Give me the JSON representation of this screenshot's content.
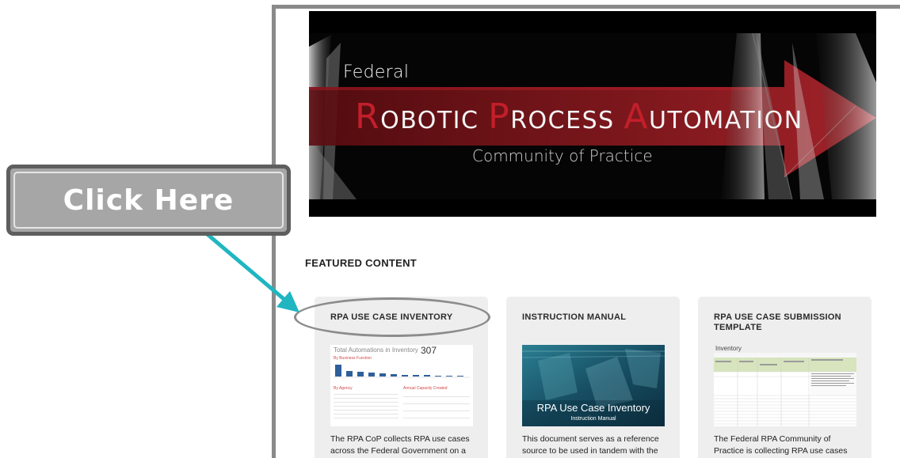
{
  "banner": {
    "subtitle": "Federal",
    "title_words": [
      {
        "cap": "R",
        "rest": "OBOTIC"
      },
      {
        "cap": "P",
        "rest": "ROCESS"
      },
      {
        "cap": "A",
        "rest": "UTOMATION"
      }
    ],
    "community": "Community of Practice"
  },
  "featured": {
    "heading": "FEATURED CONTENT",
    "cards": [
      {
        "title": "RPA USE CASE INVENTORY",
        "description": "The RPA CoP collects RPA use cases across the Federal Government on a",
        "thumb": {
          "heading": "Total Automations in Inventory",
          "total": "307",
          "section1": "By Business Function",
          "section2": "By Agency",
          "section3": "Annual Capacity Created"
        }
      },
      {
        "title": "INSTRUCTION MANUAL",
        "description": "This document serves as a reference source to be used in tandem with the Use",
        "thumb": {
          "title": "RPA Use Case Inventory",
          "subtitle": "Instruction Manual"
        }
      },
      {
        "title": "RPA USE CASE SUBMISSION TEMPLATE",
        "description": "The Federal RPA Community of Practice is collecting RPA use cases from teams",
        "thumb": {
          "title": "Inventory"
        }
      }
    ]
  },
  "callout": {
    "label": "Click Here",
    "colors": {
      "box": "#a6a6a6",
      "border": "#5e5e5e",
      "arrow": "#1fb6c1",
      "ellipse": "#8c8c8c"
    }
  },
  "colors": {
    "accent_red": "#c21f2a",
    "banner_bg": "#050505"
  }
}
